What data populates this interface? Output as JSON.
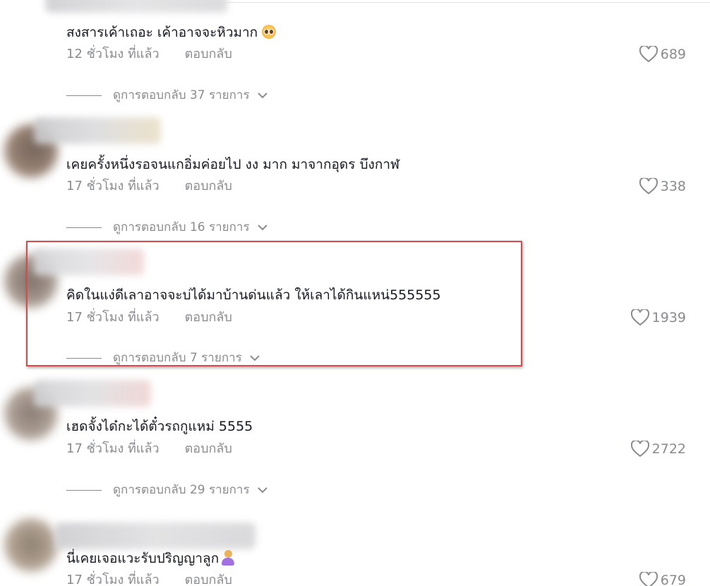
{
  "colors": {
    "text_primary": "#161823",
    "text_secondary": "#8a8b91",
    "highlight_border": "#d94a4d"
  },
  "comments": [
    {
      "text": "สงสารเค้าเถอะ เค้าอาจจะหิวมาก",
      "emoji": "pleading-face",
      "time": "12 ชั่วโมง ที่แล้ว",
      "reply_label": "ตอบกลับ",
      "likes": "689",
      "view_replies": "ดูการตอบกลับ 37 รายการ"
    },
    {
      "text": "เคยครั้งหนึ่งรอจนแกอิ่มค่อยไป งง มาก มาจากอุดร บึงกาฬ",
      "time": "17 ชั่วโมง ที่แล้ว",
      "reply_label": "ตอบกลับ",
      "likes": "338",
      "view_replies": "ดูการตอบกลับ 16 รายการ"
    },
    {
      "text": "คิดในแง่ดีเลาอาจจะบ่ได้มาบ้านด่นแล้ว ให้เลาได้กินแหน่555555",
      "time": "17 ชั่วโมง ที่แล้ว",
      "reply_label": "ตอบกลับ",
      "likes": "1939",
      "view_replies": "ดูการตอบกลับ 7 รายการ",
      "highlighted": true
    },
    {
      "text": "เฮดจั้งได๋กะได้ตั๋วรถกูแหม่ 5555",
      "time": "17 ชั่วโมง ที่แล้ว",
      "reply_label": "ตอบกลับ",
      "likes": "2722",
      "view_replies": "ดูการตอบกลับ 29 รายการ"
    },
    {
      "text": "นี่เคยเจอแวะรับปริญญาลูก",
      "emoji": "person-emoji",
      "time": "17 ชั่วโมง ที่แล้ว",
      "reply_label": "ตอบกลับ",
      "likes": "679"
    }
  ]
}
